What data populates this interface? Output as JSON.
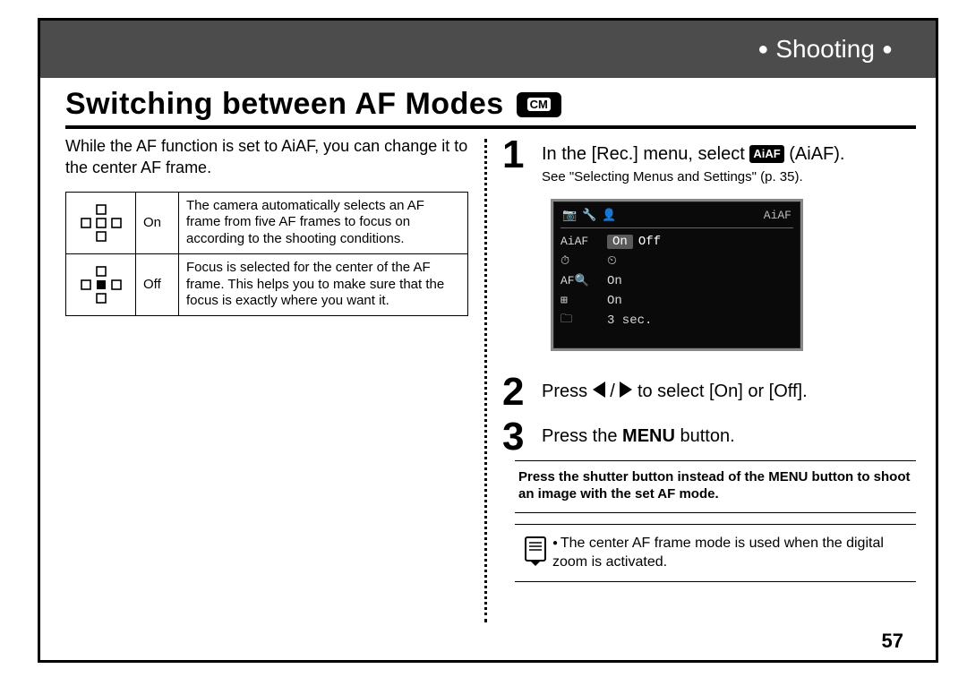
{
  "header": {
    "section": "Shooting"
  },
  "title": "Switching between AF Modes",
  "mode_badge": "CM",
  "intro": "While the AF function is set to AiAF, you can change it to the center AF frame.",
  "table": {
    "rows": [
      {
        "state": "On",
        "desc": "The camera automatically selects an AF frame from five AF frames to focus on according to the shooting conditions."
      },
      {
        "state": "Off",
        "desc": "Focus is selected for the center of the AF frame. This helps you to make sure that the focus is exactly where you want it."
      }
    ]
  },
  "steps": {
    "s1": {
      "num": "1",
      "text_pre": "In the [Rec.] menu, select ",
      "badge": "AiAF",
      "text_post": " (AiAF).",
      "sub": "See \"Selecting Menus and Settings\" (p. 35)."
    },
    "s2": {
      "num": "2",
      "text_pre": "Press ",
      "text_mid": " / ",
      "text_post": " to select [On] or [Off]."
    },
    "s3": {
      "num": "3",
      "text_pre": "Press the ",
      "bold": "MENU",
      "text_post": " button."
    }
  },
  "note": {
    "pre": "Press the shutter button instead of the ",
    "bold": "MENU",
    "post": " button to shoot an image with the set AF mode."
  },
  "memo": "The center AF frame mode is used when the digital zoom is activated.",
  "lcd": {
    "title_right": "AiAF",
    "rows": [
      {
        "label": "AiAF",
        "value": "On",
        "alt": "Off",
        "selected": true
      },
      {
        "label": "⏱",
        "value": "⏲",
        "selected": false
      },
      {
        "label": "AF🔍",
        "value": "On",
        "selected": false
      },
      {
        "label": "⊞",
        "value": "On",
        "selected": false
      },
      {
        "label": "🗀",
        "value": "3 sec.",
        "selected": false
      }
    ]
  },
  "page_number": "57"
}
